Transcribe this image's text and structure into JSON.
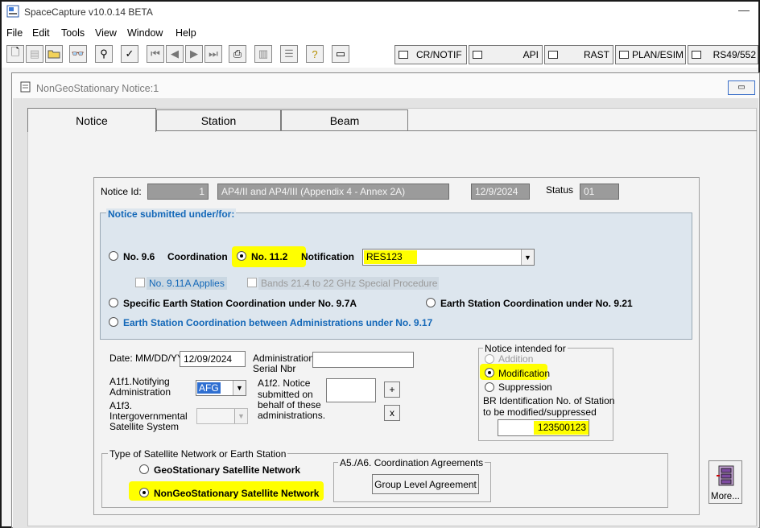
{
  "app": {
    "title": "SpaceCapture v10.0.14 BETA",
    "minimize": "—"
  },
  "menu": [
    "File",
    "Edit",
    "Tools",
    "View",
    "Window",
    "Help"
  ],
  "toolbar": {
    "tabs": [
      "CR/NOTIF",
      "API",
      "RAST",
      "PLAN/ESIM",
      "RS49/552"
    ]
  },
  "child": {
    "title": "NonGeoStationary Notice:1"
  },
  "tabs": {
    "notice": "Notice",
    "station": "Station",
    "beam": "Beam"
  },
  "notice": {
    "id_label": "Notice Id:",
    "id_value": "1",
    "type_value": "AP4/II and AP4/III (Appendix 4 - Annex 2A)",
    "date_value": "12/9/2024",
    "status_label": "Status",
    "status_value": "01"
  },
  "submitted": {
    "legend": "Notice submitted under/for:",
    "opt_96_num": "No. 9.6",
    "opt_96_label": "Coordination",
    "opt_112_num": "No. 11.2",
    "opt_112_label": "Notification",
    "notification_value": "RES123",
    "chk_911a": "No. 9.11A Applies",
    "chk_bands": "Bands 21.4 to 22 GHz Special Procedure",
    "opt_specific": "Specific Earth Station Coordination under No. 9.7A",
    "opt_921": "Earth Station Coordination under No. 9.21",
    "opt_917": "Earth Station Coordination between Administrations under No. 9.17"
  },
  "form": {
    "date_label": "Date:  MM/DD/YY",
    "date_value": "12/09/2024",
    "admin_serial_label_1": "Administration",
    "admin_serial_label_2": "Serial Nbr",
    "admin_serial_value": "",
    "a1f1_label_1": "A1f1.Notifying",
    "a1f1_label_2": "Administration",
    "a1f1_value": "AFG",
    "a1f2_label_1": "A1f2. Notice",
    "a1f2_label_2": "submitted on",
    "a1f2_label_3": "behalf of these",
    "a1f2_label_4": "administrations.",
    "add_btn": "+",
    "remove_btn": "x",
    "a1f3_label_1": "A1f3.",
    "a1f3_label_2": "Intergovernmental",
    "a1f3_label_3": "Satellite System",
    "a1f3_value": ""
  },
  "intended": {
    "legend": "Notice intended for",
    "addition": "Addition",
    "modification": "Modification",
    "suppression": "Suppression",
    "br_label_1": "BR Identification No. of Station",
    "br_label_2": "to be modified/suppressed",
    "br_value": "123500123"
  },
  "network_type": {
    "legend": "Type of Satellite Network or Earth Station",
    "geo": "GeoStationary Satellite Network",
    "nongeo": "NonGeoStationary Satellite Network"
  },
  "agreements": {
    "legend": "A5./A6. Coordination Agreements",
    "button": "Group Level Agreement"
  },
  "more": {
    "label": "More..."
  },
  "colors": {
    "highlight": "#ffff00",
    "blue_label": "#1468b8",
    "panel_blue": "#dde6ee"
  }
}
